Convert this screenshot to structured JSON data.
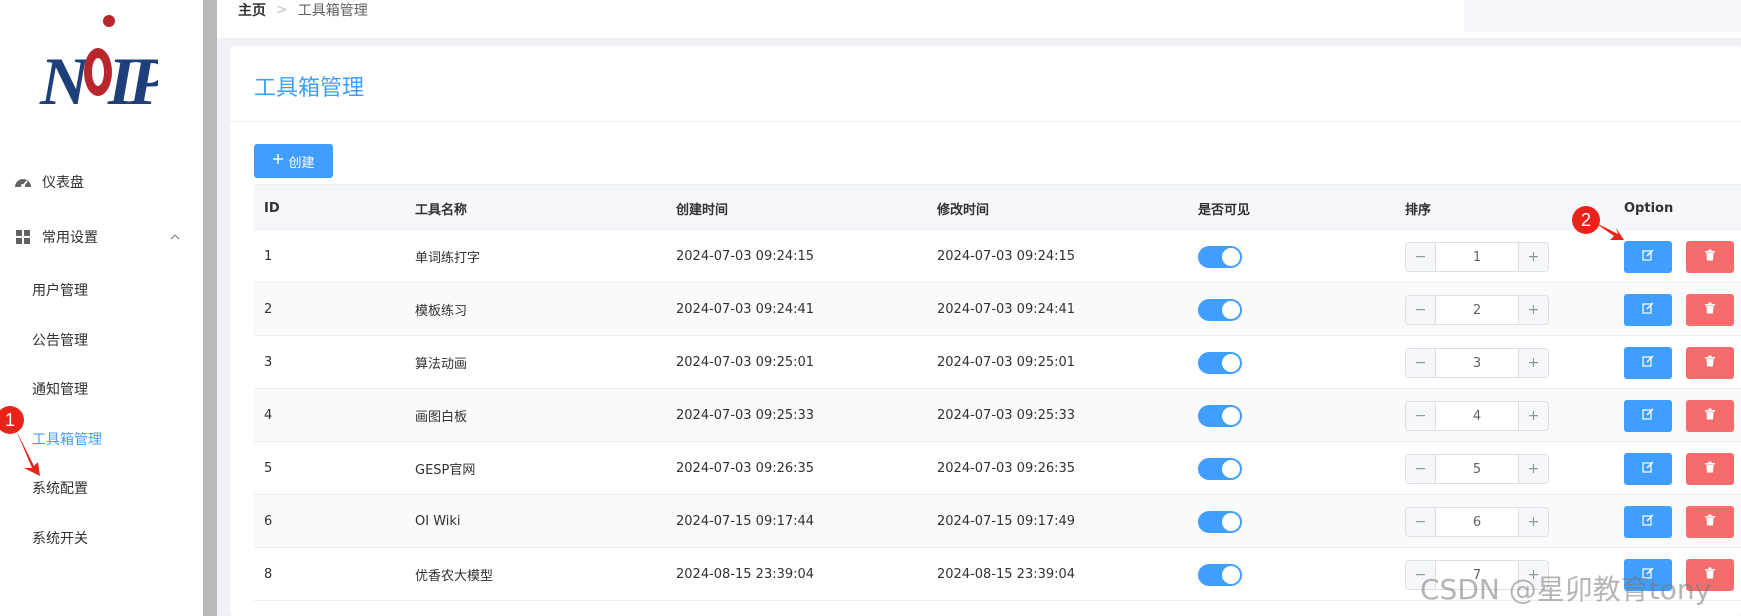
{
  "brand": {
    "logo_text": "NOIP"
  },
  "sidebar": {
    "dashboard": {
      "label": "仪表盘",
      "icon": "dashboard-icon"
    },
    "settings_group": {
      "label": "常用设置",
      "icon": "grid-icon",
      "expanded": true
    },
    "sub_items": [
      {
        "label": "用户管理",
        "active": false
      },
      {
        "label": "公告管理",
        "active": false
      },
      {
        "label": "通知管理",
        "active": false
      },
      {
        "label": "工具箱管理",
        "active": true
      },
      {
        "label": "系统配置",
        "active": false
      },
      {
        "label": "系统开关",
        "active": false
      }
    ]
  },
  "annotations": {
    "marker1": "1",
    "marker2": "2"
  },
  "breadcrumb": {
    "home": "主页",
    "separator": ">",
    "current": "工具箱管理"
  },
  "page": {
    "title": "工具箱管理",
    "create_label": "创建"
  },
  "table": {
    "headers": {
      "id": "ID",
      "name": "工具名称",
      "created": "创建时间",
      "modified": "修改时间",
      "visible": "是否可见",
      "order": "排序",
      "option": "Option"
    },
    "rows": [
      {
        "id": "1",
        "name": "单词练打字",
        "created": "2024-07-03 09:24:15",
        "modified": "2024-07-03 09:24:15",
        "visible": true,
        "order": "1"
      },
      {
        "id": "2",
        "name": "模板练习",
        "created": "2024-07-03 09:24:41",
        "modified": "2024-07-03 09:24:41",
        "visible": true,
        "order": "2"
      },
      {
        "id": "3",
        "name": "算法动画",
        "created": "2024-07-03 09:25:01",
        "modified": "2024-07-03 09:25:01",
        "visible": true,
        "order": "3"
      },
      {
        "id": "4",
        "name": "画图白板",
        "created": "2024-07-03 09:25:33",
        "modified": "2024-07-03 09:25:33",
        "visible": true,
        "order": "4"
      },
      {
        "id": "5",
        "name": "GESP官网",
        "created": "2024-07-03 09:26:35",
        "modified": "2024-07-03 09:26:35",
        "visible": true,
        "order": "5"
      },
      {
        "id": "6",
        "name": "OI Wiki",
        "created": "2024-07-15 09:17:44",
        "modified": "2024-07-15 09:17:49",
        "visible": true,
        "order": "6"
      },
      {
        "id": "8",
        "name": "优香农大模型",
        "created": "2024-08-15 23:39:04",
        "modified": "2024-08-15 23:39:04",
        "visible": true,
        "order": "7"
      }
    ]
  },
  "watermark": "CSDN @星卯教育tony",
  "colors": {
    "primary": "#409eff",
    "danger": "#f56c6c",
    "marker": "#e8231a"
  }
}
